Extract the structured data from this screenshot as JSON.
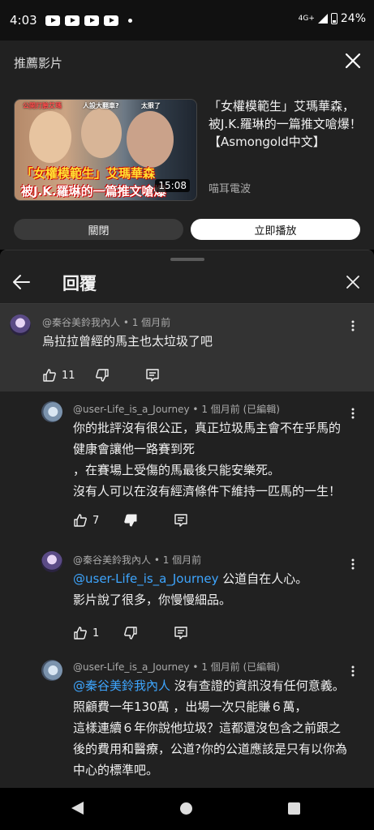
{
  "status_bar": {
    "time": "4:03",
    "network": "4G+",
    "battery": "24%"
  },
  "recommended": {
    "header": "推薦影片",
    "video_title": "「女權模範生」艾瑪華森，被J.K.羅琳的一篇推文嗆爆！【Asmongold中文】",
    "channel": "喵耳電波",
    "duration": "15:08",
    "thumbnail_tags": [
      "公開打臉艾瑪",
      "人設大翻車?",
      "太狠了"
    ],
    "thumbnail_caption_1": "「女權模範生」艾瑪華森",
    "thumbnail_caption_2": "被J.K.羅琳的一篇推文嗆爆",
    "close_label": "關閉",
    "play_label": "立即播放"
  },
  "replies": {
    "title": "回覆",
    "parent": {
      "author": "@秦谷美鈴我內人",
      "time": "1 個月前",
      "text": "烏拉拉曾經的馬主也太垃圾了吧",
      "likes": "11"
    },
    "items": [
      {
        "author": "@user-Life_is_a_Journey",
        "time": "1 個月前 (已編輯)",
        "lines": [
          "你的批評沒有很公正，真正垃圾馬主會不在乎馬的",
          "健康會讓他一路賽到死",
          "，在賽場上受傷的馬最後只能安樂死。",
          "沒有人可以在沒有經濟條件下維持一匹馬的一生！"
        ],
        "likes": "7"
      },
      {
        "author": "@秦谷美鈴我內人",
        "time": "1 個月前",
        "mention": "@user-Life_is_a_Journey",
        "line1_rest": " 公道自在人心。",
        "line2": "影片說了很多，你慢慢細品。",
        "likes": "1"
      },
      {
        "author": "@user-Life_is_a_Journey",
        "time": "1 個月前 (已編輯)",
        "mention": "@秦谷美鈴我內人",
        "line1_rest": " 沒有查證的資訊沒有任何意義。",
        "lines": [
          "照顧費一年130萬 ，出場一次只能賺６萬，",
          "這樣連續６年你說他垃圾？這都還沒包含之前跟之",
          "後的費用和醫療，公道?你的公道應該是只有以你為",
          "中心的標準吧。"
        ]
      }
    ]
  },
  "icons": {
    "close": "close-icon",
    "back": "arrow-left-icon",
    "more": "more-vert-icon",
    "like": "thumb-up-icon",
    "dislike": "thumb-down-icon",
    "reply": "comment-icon"
  },
  "colors": {
    "background": "#212121",
    "highlight": "#333333",
    "mention": "#3ea6ff",
    "muted": "#aaaaaa"
  }
}
